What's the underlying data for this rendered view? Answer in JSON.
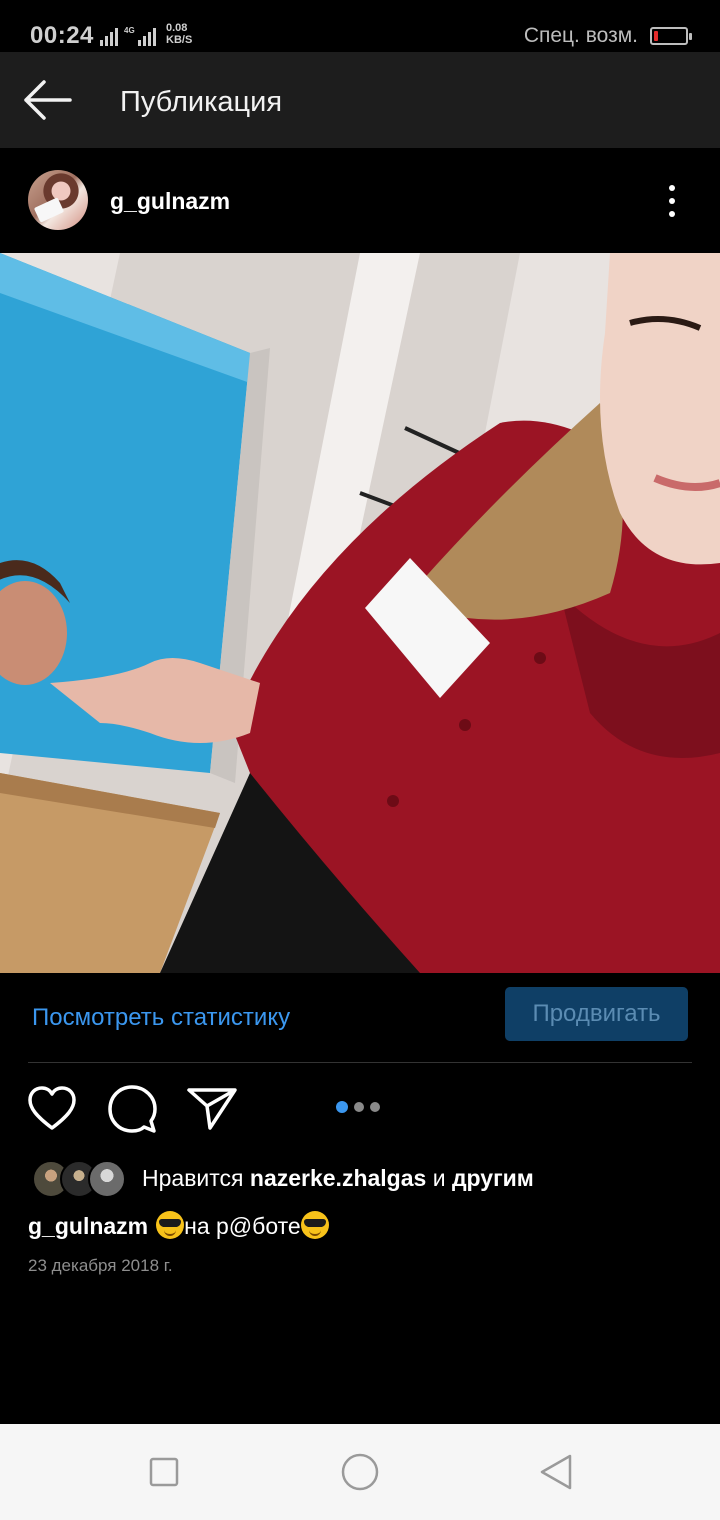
{
  "status_bar": {
    "time": "00:24",
    "network": "4G",
    "speed_value": "0.08",
    "speed_unit": "KB/S",
    "accessibility_label": "Спец. возм.",
    "battery_color": "#e52b2b"
  },
  "app_bar": {
    "title": "Публикация",
    "back_icon": "arrow-left-icon"
  },
  "post": {
    "username": "g_gulnaz m",
    "more_icon": "more-vertical-icon",
    "photo_description_icon": "photo"
  },
  "insights": {
    "stats_link": "Посмотреть статистику",
    "promote_button": "Продвигать",
    "link_color": "#3b97ef",
    "promote_bg": "#0f3f66"
  },
  "actions": {
    "like_icon": "heart-icon",
    "comment_icon": "comment-icon",
    "share_icon": "send-icon",
    "carousel_total": 3,
    "carousel_active": 1
  },
  "likes": {
    "prefix": "Нравится ",
    "user": "nazerke.zhalgas",
    "middle": " и ",
    "others": "другим"
  },
  "caption": {
    "username": "g_gulnazm",
    "text": "на р@боте"
  },
  "date": "23 декабря 2018 г.",
  "nav_bar": {
    "recent_icon": "square-icon",
    "home_icon": "circle-icon",
    "back_icon": "triangle-back-icon"
  }
}
